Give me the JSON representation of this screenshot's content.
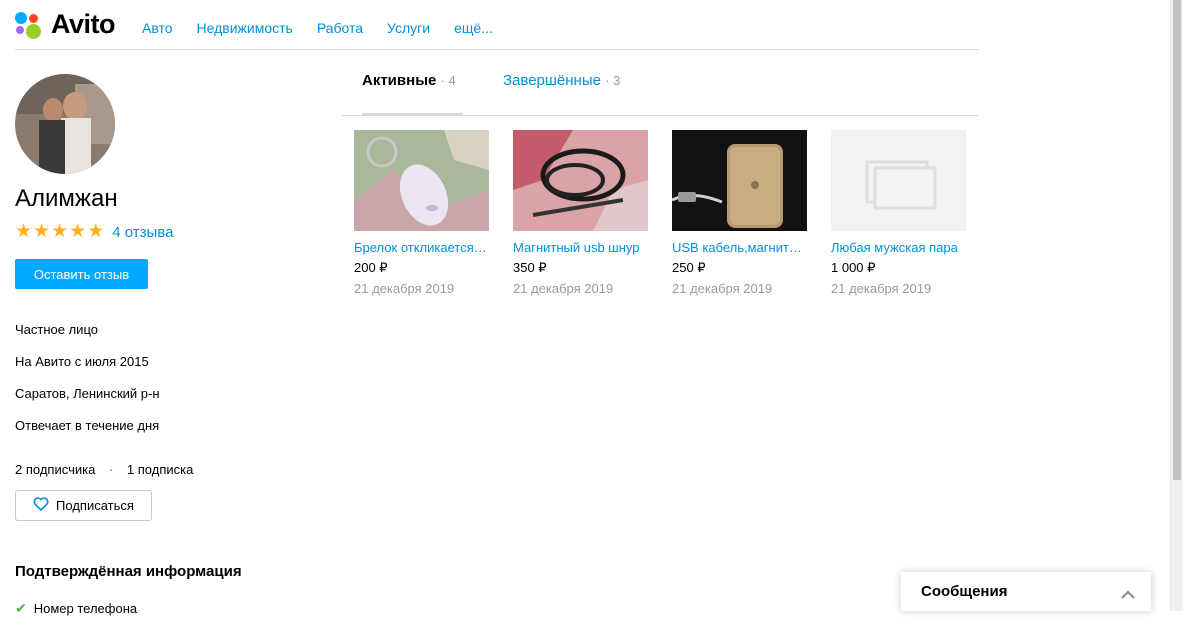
{
  "brand": {
    "logo_text": "Avito",
    "dot_colors": [
      "#0af",
      "#f42",
      "#97cf26",
      "#a169f7"
    ]
  },
  "nav": [
    "Авто",
    "Недвижимость",
    "Работа",
    "Услуги",
    "ещё..."
  ],
  "profile": {
    "name": "Алимжан",
    "rating_stars": 5,
    "reviews_link": "4 отзыва",
    "review_button": "Оставить отзыв",
    "info": [
      "Частное лицо",
      "На Авито с июля 2015",
      "Саратов, Ленинский р-н",
      "Отвечает в течение дня"
    ],
    "subscribers": "2 подписчика",
    "subscriptions": "1 подписка",
    "subscribe_button": "Подписаться",
    "verified_title": "Подтверждённая информация",
    "verified_items": [
      "Номер телефона"
    ]
  },
  "tabs": [
    {
      "label": "Активные",
      "count": "· 4",
      "active": true
    },
    {
      "label": "Завершённые",
      "count": "· 3",
      "active": false
    }
  ],
  "items": [
    {
      "title": "Брелок откликается на свист",
      "price": "200 ₽",
      "date": "21 декабря 2019",
      "image": "keychain"
    },
    {
      "title": "Магнитный usb шнур",
      "price": "350 ₽",
      "date": "21 декабря 2019",
      "image": "cable"
    },
    {
      "title": "USB кабель,магнитный",
      "price": "250 ₽",
      "date": "21 декабря 2019",
      "image": "phone-cable"
    },
    {
      "title": "Любая мужская пара",
      "price": "1 000 ₽",
      "date": "21 декабря 2019",
      "image": "placeholder"
    }
  ],
  "messages": {
    "title": "Сообщения"
  },
  "colors": {
    "link": "#0091d9",
    "accent": "#00aaff",
    "star": "#ffb021",
    "check": "#4ab847"
  }
}
